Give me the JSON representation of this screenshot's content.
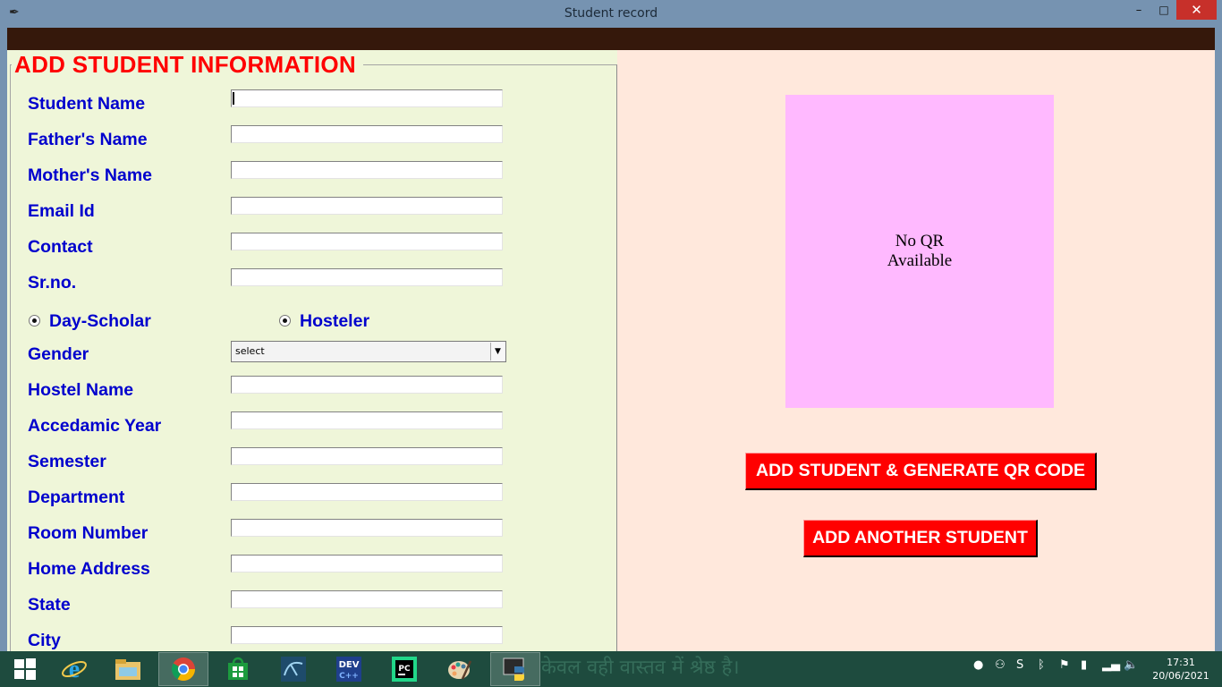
{
  "window": {
    "title": "Student record",
    "minimize_glyph": "–",
    "maximize_glyph": "□",
    "close_glyph": "✕",
    "app_icon_glyph": "✒"
  },
  "form": {
    "section_title": "ADD STUDENT INFORMATION",
    "fields": {
      "student_name": {
        "label": "Student Name",
        "value": ""
      },
      "father_name": {
        "label": "Father's Name",
        "value": ""
      },
      "mother_name": {
        "label": "Mother's Name",
        "value": ""
      },
      "email": {
        "label": "Email Id",
        "value": ""
      },
      "contact": {
        "label": "Contact",
        "value": ""
      },
      "sr_no": {
        "label": "Sr.no.",
        "value": ""
      },
      "hostel_name": {
        "label": "Hostel Name",
        "value": ""
      },
      "academic_year": {
        "label": "Accedamic Year",
        "value": ""
      },
      "semester": {
        "label": "Semester",
        "value": ""
      },
      "department": {
        "label": "Department",
        "value": ""
      },
      "room_number": {
        "label": "Room Number",
        "value": ""
      },
      "home_address": {
        "label": "Home Address",
        "value": ""
      },
      "state": {
        "label": "State",
        "value": ""
      },
      "city": {
        "label": "City",
        "value": ""
      }
    },
    "residence": {
      "day_scholar_label": "Day-Scholar",
      "hosteler_label": "Hosteler"
    },
    "gender": {
      "label": "Gender",
      "selected": "select",
      "arrow_glyph": "▼"
    }
  },
  "qr": {
    "line1": "No QR",
    "line2": "Available"
  },
  "buttons": {
    "generate_label": "ADD STUDENT & GENERATE QR CODE",
    "another_label": "ADD ANOTHER STUDENT"
  },
  "taskbar": {
    "wallpaper_text": "केवल वही वास्तव में श्रेष्ठ है।",
    "time": "17:31",
    "date": "20/06/2021",
    "icons": [
      "windows-start-icon",
      "internet-explorer-icon",
      "file-explorer-icon",
      "chrome-icon",
      "store-icon",
      "mysql-workbench-icon",
      "dev-cpp-icon",
      "pycharm-icon",
      "paint-icon",
      "python-idle-icon"
    ],
    "tray_icons": [
      "discord-icon",
      "people-icon",
      "skype-icon",
      "bluetooth-icon",
      "flag-icon",
      "network-adapter-icon",
      "signal-icon",
      "volume-icon"
    ]
  },
  "colors": {
    "title_bar": "#7693b1",
    "menubar": "#35180b",
    "left_panel": "#eff6d9",
    "right_panel": "#ffe8dc",
    "label_blue": "#0000cd",
    "heading_red": "#ff0000",
    "qr_box": "#ffb9ff",
    "button_red": "#ff0000"
  }
}
